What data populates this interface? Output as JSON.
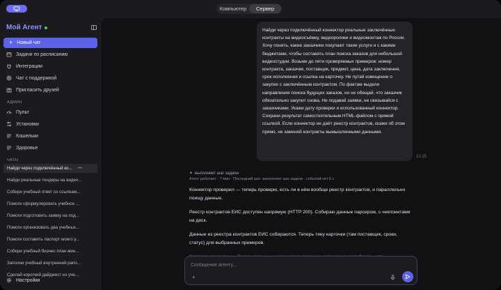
{
  "topbar": {
    "tabs": [
      {
        "label": "Компьютер",
        "active": false
      },
      {
        "label": "Сервер",
        "active": true
      }
    ]
  },
  "sidebar": {
    "brand": "Мой Агент",
    "new_chat": "Новый чат",
    "items": [
      {
        "label": "Задачи по расписанию",
        "icon": "calendar-icon"
      },
      {
        "label": "Интеграции",
        "icon": "plug-icon"
      },
      {
        "label": "Чат с поддержкой",
        "icon": "support-icon"
      },
      {
        "label": "Пригласить друзей",
        "icon": "gift-icon"
      }
    ],
    "admin_label": "АДМИН",
    "admin_items": [
      {
        "label": "Пульт",
        "icon": "gauge-icon"
      },
      {
        "label": "Установки",
        "icon": "sliders-icon"
      },
      {
        "label": "Кошельки",
        "icon": "list-icon"
      },
      {
        "label": "Здоровье",
        "icon": "list-icon"
      }
    ],
    "chats_label": "ЧАТЫ",
    "chats": [
      "Найди через подключённый ко...",
      "Найди реальные тендеры на видео...",
      "Собери учебный ответ со ссылкам...",
      "Помоги сформулировать учебное ...",
      "Помоги подготовить заявку на под...",
      "Помоги организовать два учебных...",
      "Помоги составить паспорт моего у...",
      "Собери учебный бизнес-план мин...",
      "Заполни учебный внутренний рапо...",
      "Сделай короткий дайджест из уче..."
    ],
    "settings": "Настройки"
  },
  "main": {
    "user_message": "Найди через подключённый коннектор реальные заключённые контракты на видеосъёмку, видеоролики и видеомонтаж по России. Хочу понять, какие заказчики покупают такие услуги и с какими бюджетами, чтобы составить план поиска заказов для небольшой видеостудии. Возьми до пяти проверяемых примеров: номер контракта, заказчик, поставщик, предмет, цена, дата заключения, срок исполнения и ссылка на карточку. Не путай извещение о закупке с заключённым контрактом. По фактам выдели направления поиска будущих заказов, но не обещай, что заказчик обязательно закупит снова. Не подавай заявки, не связывайся с заказчиками. Укажи дату проверки и использованный коннектор. Сохрани результат самостоятельным HTML-файлом с прямой ссылкой. Если коннектор не даёт реестр контрактов, скажи об этом прямо, не заменяй контракты вымышленными данными.",
    "time": "10:25",
    "status": "выполняет шаг задачи",
    "meta": "Агент работает · 7 мин · Последний шаг: выполняет шаг задачи · событий нет 6 с",
    "reply": [
      "Коннектор проверил — теперь проверю, есть ли в нём вообще реестр контрактов, и параллельно поищу данные.",
      "Реестр контрактов ЕИС доступен напрямую (HTTP 200). Собираю данные парсером, с чекпоинтами на диск.",
      "Данные из реестра контрактов ЕИС собираются. Теперь тяну карточки (там поставщик, сроки, статус) для выбранных примеров.",
      "Карточки проверены. Теперь возьму из коннектора текущие извещения (для блока «что"
    ],
    "composer_placeholder": "Сообщение агенту..."
  },
  "colors": {
    "accent": "#5c63e6",
    "brand": "#8f93ff",
    "online": "#3ecf6e"
  }
}
